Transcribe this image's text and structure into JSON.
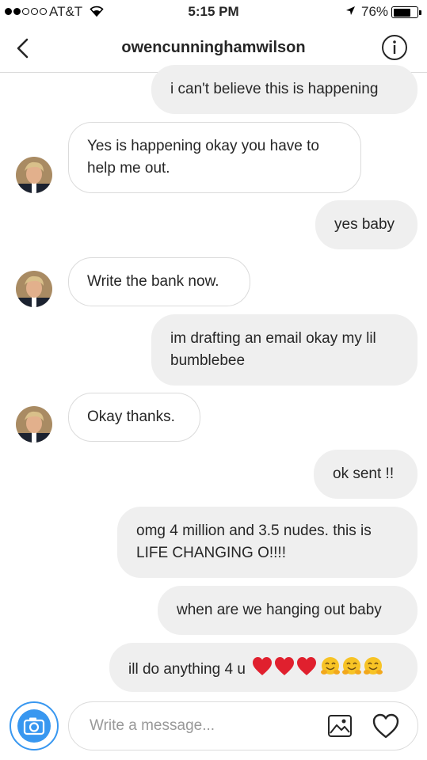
{
  "status_bar": {
    "carrier": "AT&T",
    "time": "5:15 PM",
    "battery_percent_label": "76%",
    "battery_level": 0.76,
    "signal_bars_filled": 2,
    "signal_bars_total": 5
  },
  "header": {
    "title": "owencunninghamwilson"
  },
  "messages": [
    {
      "from": "me",
      "lines": [
        "i can't believe this is happening"
      ]
    },
    {
      "from": "them",
      "lines": [
        "Yes is happening okay you have to",
        "help me out."
      ]
    },
    {
      "from": "me",
      "lines": [
        "yes baby"
      ]
    },
    {
      "from": "them",
      "lines": [
        "Write the bank now."
      ]
    },
    {
      "from": "me",
      "lines": [
        "im drafting an email okay my lil",
        "bumblebee"
      ]
    },
    {
      "from": "them",
      "lines": [
        "Okay thanks."
      ]
    },
    {
      "from": "me",
      "lines": [
        "ok sent !!"
      ]
    },
    {
      "from": "me",
      "lines": [
        "omg 4 million and 3.5 nudes. this is",
        "LIFE CHANGING O!!!!"
      ]
    },
    {
      "from": "me",
      "lines": [
        "when are we hanging out baby"
      ]
    },
    {
      "from": "me",
      "lines": [
        "ill do anything 4 u"
      ],
      "emoji": [
        "red-heart",
        "red-heart",
        "red-heart",
        "hugging-face",
        "hugging-face",
        "hugging-face"
      ]
    }
  ],
  "composer": {
    "placeholder": "Write a message..."
  },
  "colors": {
    "accent": "#3897f0",
    "outgoing_bubble": "#efefef",
    "incoming_border": "#dbdbdb",
    "heart": "#e0202e",
    "hug_emoji": "#f7c325"
  }
}
